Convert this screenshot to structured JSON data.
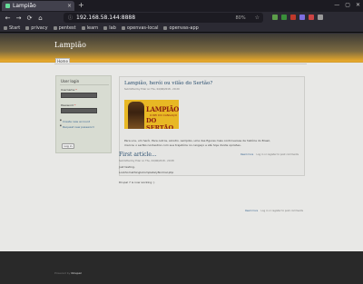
{
  "browser": {
    "tab_title": "Lampião",
    "tab_close": "×",
    "new_tab": "+",
    "window_buttons": [
      "—",
      "▢",
      "✕"
    ],
    "nav": [
      "←",
      "→",
      "⟳",
      "⌂"
    ],
    "url": "192.168.58.144:8888",
    "zoom": "80%",
    "star": "☆",
    "extension_colors": [
      "#5c9d4a",
      "#3a8f3a",
      "#c0392b",
      "#7d6ee0",
      "#cc4444",
      "#999999"
    ],
    "bookmarks": [
      "Start",
      "privacy",
      "pentest",
      "learn",
      "lab",
      "openvas-local",
      "openvas-app"
    ]
  },
  "site": {
    "name": "Lampião",
    "menu_home": "Home",
    "footer_prefix": "Powered by",
    "footer_brand": "Drupal"
  },
  "login": {
    "title": "User login",
    "username_label": "Username",
    "password_label": "Password",
    "required_mark": "*",
    "create_account": "Create new account",
    "request_password": "Request new password",
    "button": "Log in"
  },
  "articles": [
    {
      "title": "Lampião, herói ou vilão do Sertão?",
      "meta": "Submitted by Eder on Thu, 04/06/2018 - 20:29",
      "image_text_top": "LAMPIÃO",
      "image_text_mid": "O REI DO CANGAÇO",
      "image_text_bottom": "DO SERTÃO",
      "body_line1": "Para uns, um herói. Para outros, sinistro. Lampião, uma das figuras mais controversas da história do Brasil,",
      "body_line2": "marcou o sertão nordestino com sua trajetória no cangaço e até hoje divide opiniões.",
      "read_more": "Read more",
      "login_note": "Log in or register to post comments"
    },
    {
      "title": "First article...",
      "meta": "Submitted by Eder on Thu, 04/06/2018 - 20:08",
      "body_line1": "Just testing.",
      "body_line2": "LookSomethingIsCompletelyNormal.php",
      "body_line3": "Drupal 7 is now working :)",
      "read_more": "Read more",
      "login_note": "Log in or register to post comments"
    }
  ]
}
